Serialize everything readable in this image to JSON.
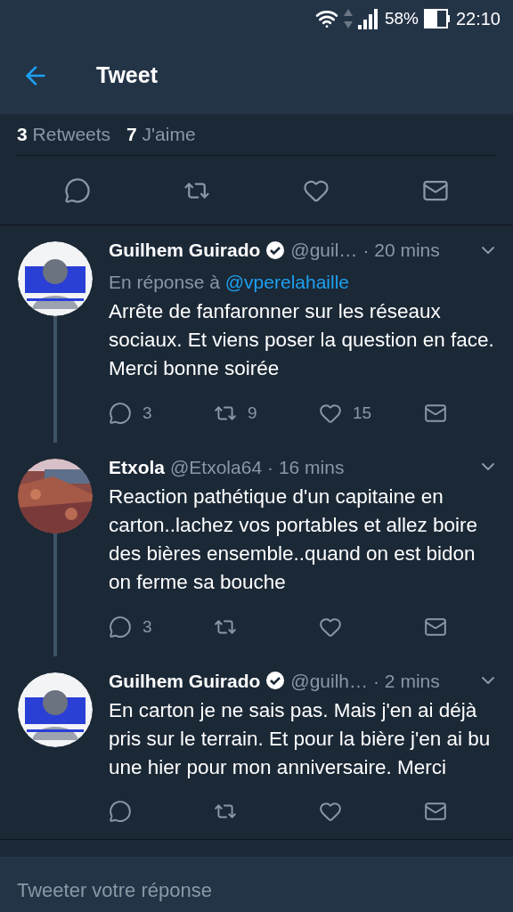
{
  "status_bar": {
    "battery": "58%",
    "time": "22:10"
  },
  "header": {
    "title": "Tweet"
  },
  "stats": [
    {
      "count": "3",
      "label": "Retweets"
    },
    {
      "count": "7",
      "label": "J'aime"
    }
  ],
  "main_actions": [
    {
      "kind": "reply"
    },
    {
      "kind": "retweet"
    },
    {
      "kind": "like"
    },
    {
      "kind": "message"
    }
  ],
  "replies": [
    {
      "name": "Guilhem Guirado",
      "verified": true,
      "handle": "@guil…",
      "time": "· 20 mins",
      "avatar": {
        "kind": "person"
      },
      "thread_line": true,
      "in_reply_to": {
        "prefix": "En réponse à",
        "mention": "@vperelahaille"
      },
      "text": "Arrête de fanfaronner sur les réseaux sociaux. Et viens poser la question en face. Merci bonne soirée",
      "actions": [
        {
          "kind": "reply",
          "count": "3"
        },
        {
          "kind": "retweet",
          "count": "9"
        },
        {
          "kind": "like",
          "count": "15"
        },
        {
          "kind": "message"
        }
      ]
    },
    {
      "name": "Etxola",
      "verified": false,
      "handle": "@Etxola64",
      "time": "· 16 mins",
      "thread_line": true,
      "text": "Reaction pathétique d'un capitaine en carton..lachez vos portables et allez boire des bières ensemble..quand on est bidon on ferme sa bouche",
      "actions": [
        {
          "kind": "reply",
          "count": "3"
        },
        {
          "kind": "retweet"
        },
        {
          "kind": "like"
        },
        {
          "kind": "message"
        }
      ]
    },
    {
      "name": "Guilhem Guirado",
      "verified": true,
      "handle": "@guilh…",
      "time": "· 2 mins",
      "avatar": {
        "kind": "person"
      },
      "thread_line": false,
      "text": "En carton je ne sais pas. Mais j'en ai déjà pris sur le terrain. Et pour la bière j'en ai bu une hier pour mon anniversaire. Merci",
      "actions": [
        {
          "kind": "reply"
        },
        {
          "kind": "retweet"
        },
        {
          "kind": "like"
        },
        {
          "kind": "message"
        }
      ]
    }
  ],
  "reply_field": {
    "placeholder": "Tweeter votre réponse"
  }
}
